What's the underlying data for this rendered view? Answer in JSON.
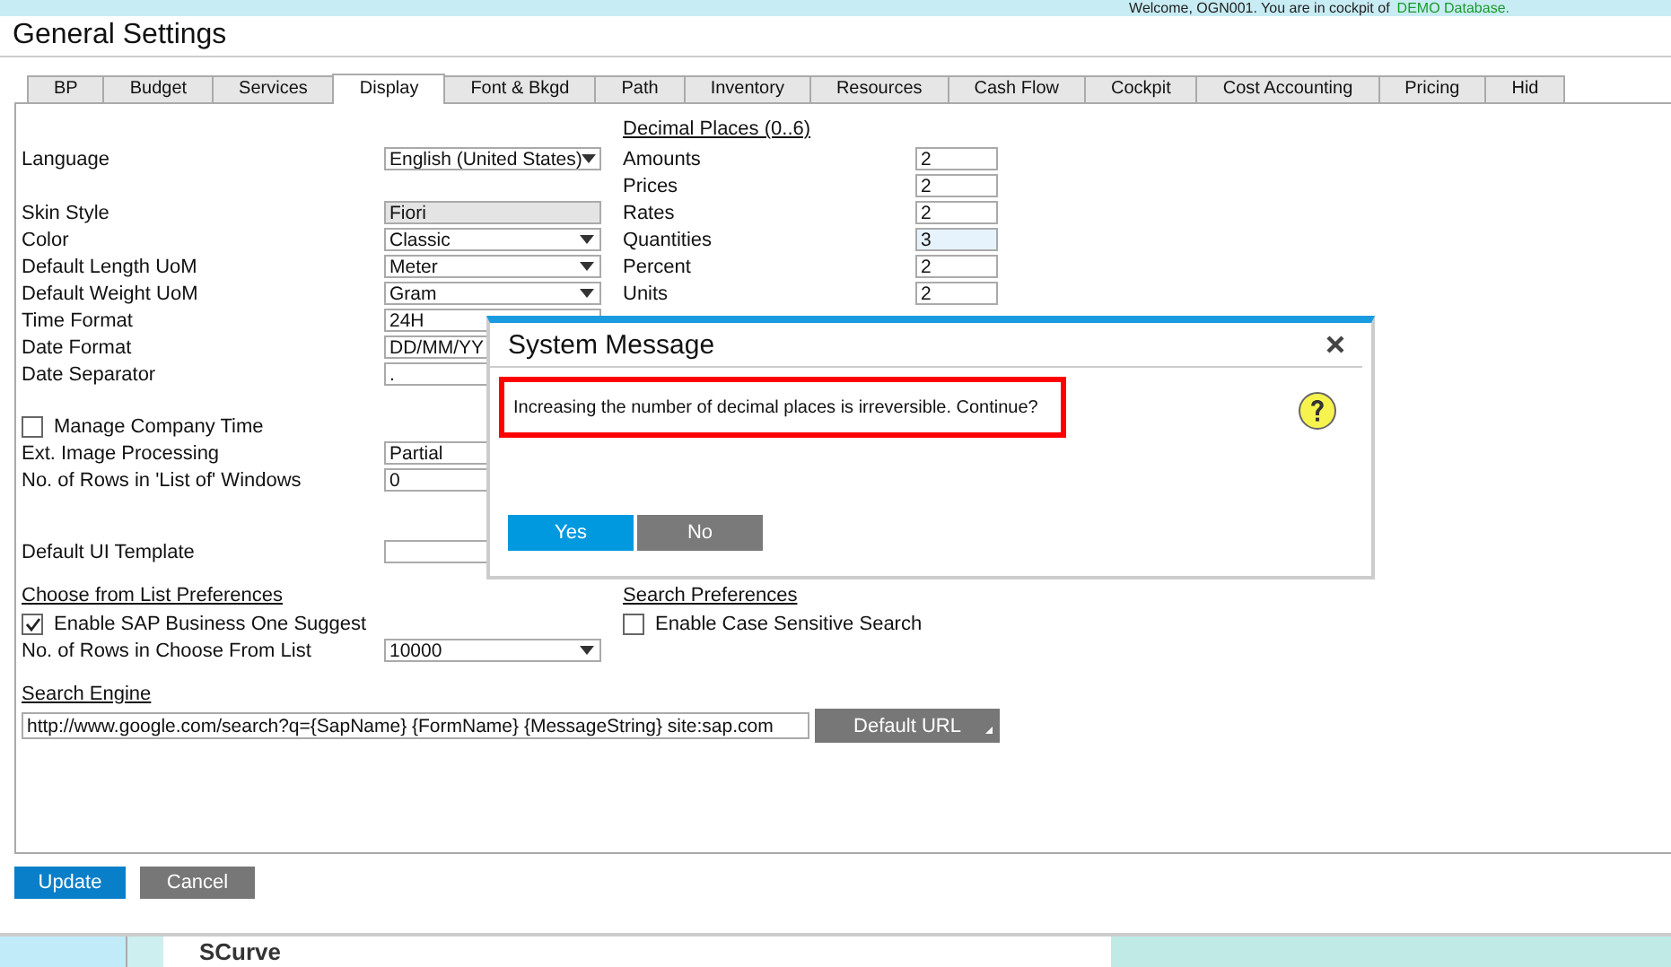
{
  "top_bar": {
    "welcome": "Welcome, OGN001. You are in cockpit of",
    "database": "DEMO Database."
  },
  "window": {
    "title": "General Settings"
  },
  "tabs": [
    {
      "label": "BP",
      "selected": false
    },
    {
      "label": "Budget",
      "selected": false
    },
    {
      "label": "Services",
      "selected": false
    },
    {
      "label": "Display",
      "selected": true
    },
    {
      "label": "Font & Bkgd",
      "selected": false
    },
    {
      "label": "Path",
      "selected": false
    },
    {
      "label": "Inventory",
      "selected": false
    },
    {
      "label": "Resources",
      "selected": false
    },
    {
      "label": "Cash Flow",
      "selected": false
    },
    {
      "label": "Cockpit",
      "selected": false
    },
    {
      "label": "Cost Accounting",
      "selected": false
    },
    {
      "label": "Pricing",
      "selected": false
    },
    {
      "label": "Hid",
      "selected": false
    }
  ],
  "display_groups": [
    [
      {
        "label": "Language",
        "kind": "dropdown",
        "value": "English (United States)"
      }
    ],
    [
      {
        "label": "Skin Style",
        "kind": "readonly",
        "value": "Fiori"
      },
      {
        "label": "Color",
        "kind": "dropdown",
        "value": "Classic"
      },
      {
        "label": "Default Length UoM",
        "kind": "dropdown",
        "value": "Meter"
      },
      {
        "label": "Default Weight UoM",
        "kind": "dropdown",
        "value": "Gram"
      },
      {
        "label": "Time Format",
        "kind": "text",
        "value": "24H"
      },
      {
        "label": "Date Format",
        "kind": "text",
        "value": "DD/MM/YY"
      },
      {
        "label": "Date Separator",
        "kind": "text",
        "value": "."
      }
    ],
    [
      {
        "label": "Manage Company Time",
        "kind": "checkbox",
        "checked": false
      },
      {
        "label": "Ext. Image Processing",
        "kind": "text",
        "value": "Partial"
      },
      {
        "label": "No. of Rows in 'List of' Windows",
        "kind": "text",
        "value": "0"
      }
    ],
    [
      {
        "label": "Default UI Template",
        "kind": "text"
      }
    ]
  ],
  "decimal_places": {
    "title": "Decimal Places  (0..6)",
    "rows": [
      {
        "label": "Amounts",
        "value": "2",
        "focused": false
      },
      {
        "label": "Prices",
        "value": "2",
        "focused": false
      },
      {
        "label": "Rates",
        "value": "2",
        "focused": false
      },
      {
        "label": "Quantities",
        "value": "3",
        "focused": true
      },
      {
        "label": "Percent",
        "value": "2",
        "focused": false
      },
      {
        "label": "Units",
        "value": "2",
        "focused": false
      }
    ]
  },
  "choose_from_list": {
    "title": "Choose from List Preferences",
    "suggest": {
      "label": "Enable SAP Business One Suggest",
      "checked": true
    },
    "rows": {
      "label": "No. of Rows in Choose From List",
      "value": "10000"
    }
  },
  "search_preferences": {
    "title": "Search Preferences",
    "case_sensitive": {
      "label": "Enable Case Sensitive Search",
      "checked": false
    }
  },
  "search_engine": {
    "title": "Search Engine",
    "url": "http://www.google.com/search?q={SapName} {FormName} {MessageString} site:sap.com",
    "button": "Default URL"
  },
  "buttons": [
    "Update",
    "Cancel"
  ],
  "footer": {
    "label": "SCurve"
  },
  "dialog": {
    "title": "System Message",
    "message": "Increasing the number of decimal places is irreversible. Continue?",
    "buttons": [
      "Yes",
      "No"
    ]
  }
}
